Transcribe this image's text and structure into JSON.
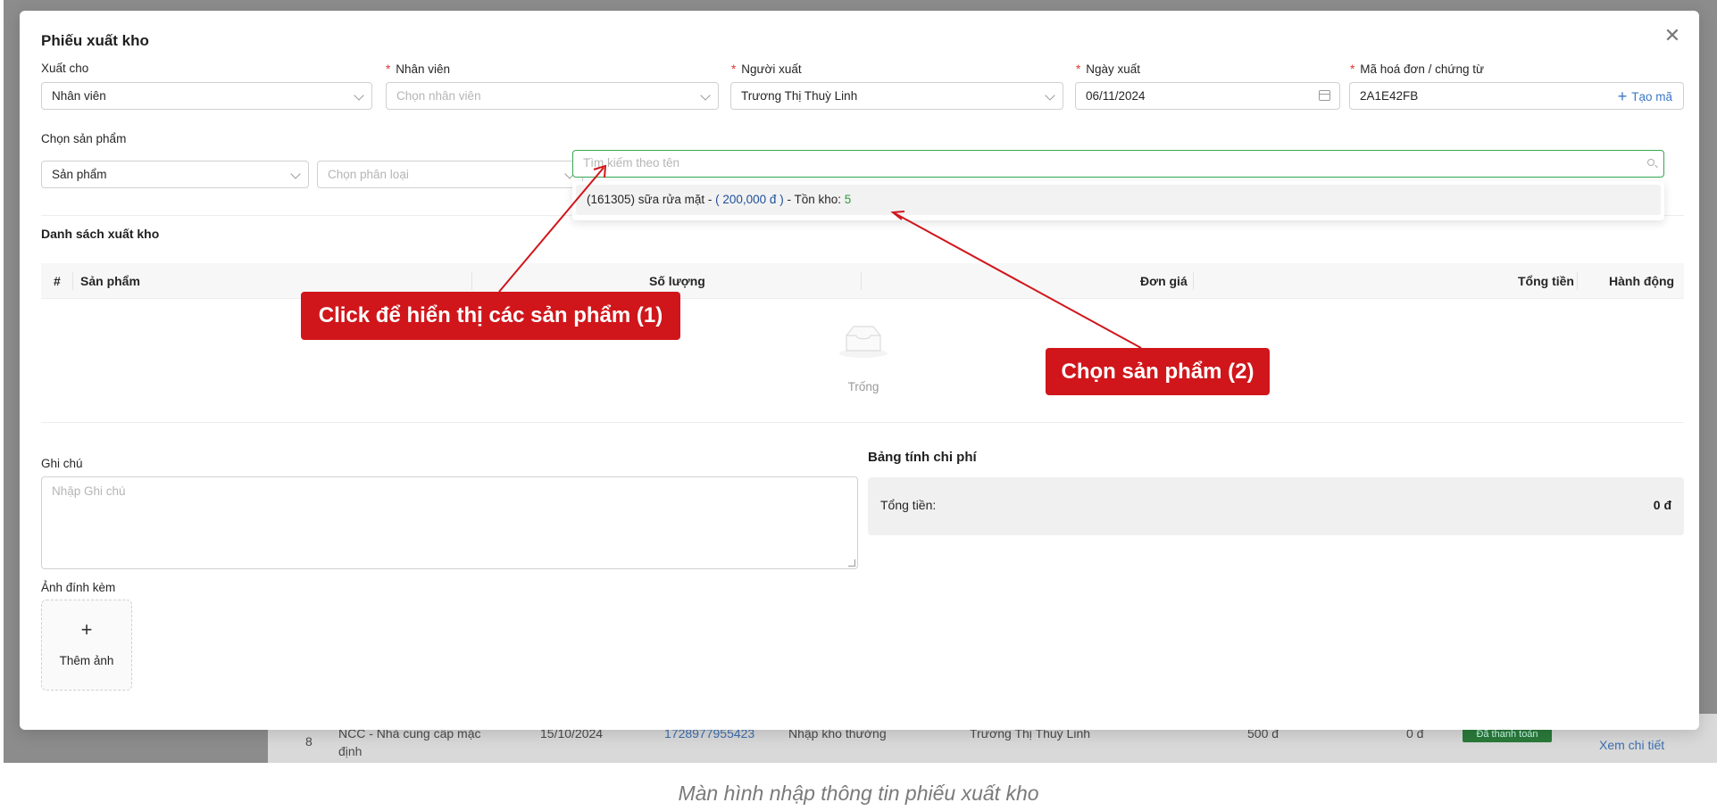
{
  "background": {
    "row_no": "8",
    "supplier_line1": "NCC - Nhà cung cấp mặc",
    "supplier_line2": "định",
    "date": "15/10/2024",
    "code": "1728977955423",
    "type": "Nhập kho thường",
    "person": "Trương Thị Thuỳ Linh",
    "amount": "500 đ",
    "debt": "0 đ",
    "status": "Đã thanh toán",
    "detail_link": "Xem chi tiết"
  },
  "modal": {
    "title": "Phiếu xuất kho",
    "close_icon": "close-icon"
  },
  "form": {
    "xuat_cho": {
      "label": "Xuất cho",
      "value": "Nhân viên"
    },
    "nhan_vien": {
      "label": "Nhân viên",
      "placeholder": "Chọn nhân viên"
    },
    "nguoi_xuat": {
      "label": "Người xuất",
      "value": "Trương Thị Thuỳ Linh"
    },
    "ngay_xuat": {
      "label": "Ngày xuất",
      "value": "06/11/2024"
    },
    "ma_hoa_don": {
      "label": "Mã hoá đơn / chứng từ",
      "value": "2A1E42FB",
      "action": "Tạo mã"
    },
    "required_mark": "*"
  },
  "product_select": {
    "label": "Chọn sản phẩm",
    "type_value": "Sản phẩm",
    "category_placeholder": "Chọn phân loại",
    "search_placeholder": "Tìm kiếm theo tên",
    "option": {
      "prefix": "(161305) sữa rửa mặt - ",
      "price": "( 200,000 đ )",
      "stock_label": " - Tồn kho: ",
      "stock": "5"
    }
  },
  "list": {
    "title": "Danh sách xuất kho",
    "columns": [
      "#",
      "Sản phẩm",
      "Số lượng",
      "Đơn giá",
      "Tổng tiền",
      "Hành động"
    ],
    "empty_text": "Trống"
  },
  "notes": {
    "label": "Ghi chú",
    "placeholder": "Nhập Ghi chú"
  },
  "cost": {
    "title": "Bảng tính chi phí",
    "total_label": "Tổng tiền:",
    "total_value": "0 đ"
  },
  "attachments": {
    "label": "Ảnh đính kèm",
    "add_label": "Thêm ảnh",
    "plus": "+"
  },
  "callouts": {
    "step1": "Click để hiển thị các sản phẩm (1)",
    "step2": "Chọn sản phẩm (2)",
    "color": "#d0161b"
  },
  "caption": "Màn hình nhập thông tin phiếu xuất kho"
}
